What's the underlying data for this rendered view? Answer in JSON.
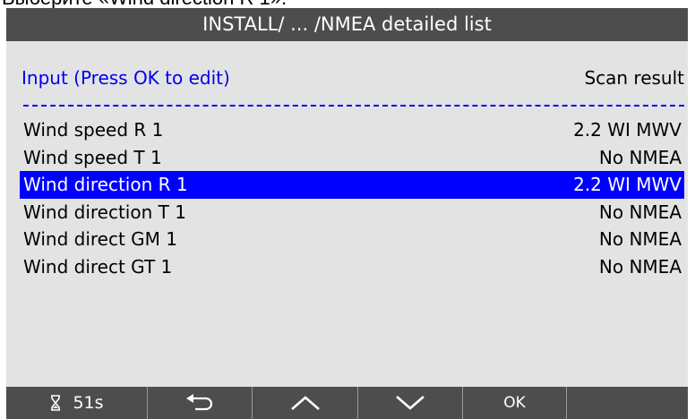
{
  "caption": "Выберите «Wind direction R 1».",
  "title": "INSTALL/ ... /NMEA detailed list",
  "header": {
    "left": "Input (Press OK to edit)",
    "right": "Scan result"
  },
  "rows": [
    {
      "label": "Wind speed R 1",
      "value": "2.2 WI MWV",
      "selected": false
    },
    {
      "label": "Wind speed T 1",
      "value": "No NMEA",
      "selected": false
    },
    {
      "label": "Wind direction R 1",
      "value": "2.2 WI MWV",
      "selected": true
    },
    {
      "label": "Wind direction T 1",
      "value": "No NMEA",
      "selected": false
    },
    {
      "label": "Wind direct GM 1",
      "value": "No NMEA",
      "selected": false
    },
    {
      "label": "Wind direct GT 1",
      "value": "No NMEA",
      "selected": false
    }
  ],
  "softkeys": {
    "timer": {
      "icon": "hourglass-icon",
      "value": "51s"
    },
    "back": {
      "icon": "return-arrow-icon"
    },
    "up": {
      "icon": "chevron-up-icon"
    },
    "down": {
      "icon": "chevron-down-icon"
    },
    "ok": {
      "label": "OK"
    }
  },
  "colors": {
    "selection": "#0000ff",
    "accent_text": "#0000ee",
    "bars": "#4d4d4d",
    "panel": "#e3e3e3"
  }
}
